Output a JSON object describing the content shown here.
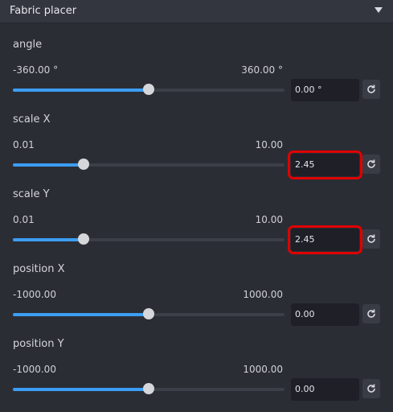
{
  "panel": {
    "title": "Fabric placer",
    "collapse_icon": "caret-down-icon"
  },
  "params": [
    {
      "label": "angle",
      "min": "-360.00 °",
      "max": "360.00 °",
      "value": "0.00 °",
      "fraction": 0.5,
      "highlighted": false
    },
    {
      "label": "scale X",
      "min": "0.01",
      "max": "10.00",
      "value": "2.45",
      "fraction": 0.26,
      "highlighted": true
    },
    {
      "label": "scale Y",
      "min": "0.01",
      "max": "10.00",
      "value": "2.45",
      "fraction": 0.26,
      "highlighted": true
    },
    {
      "label": "position X",
      "min": "-1000.00",
      "max": "1000.00",
      "value": "0.00",
      "fraction": 0.5,
      "highlighted": false
    },
    {
      "label": "position Y",
      "min": "-1000.00",
      "max": "1000.00",
      "value": "0.00",
      "fraction": 0.5,
      "highlighted": false
    }
  ],
  "reset_icon": "reset-icon",
  "colors": {
    "accent": "#3c9df4",
    "highlight": "#e00000",
    "background": "#2b2d35"
  }
}
